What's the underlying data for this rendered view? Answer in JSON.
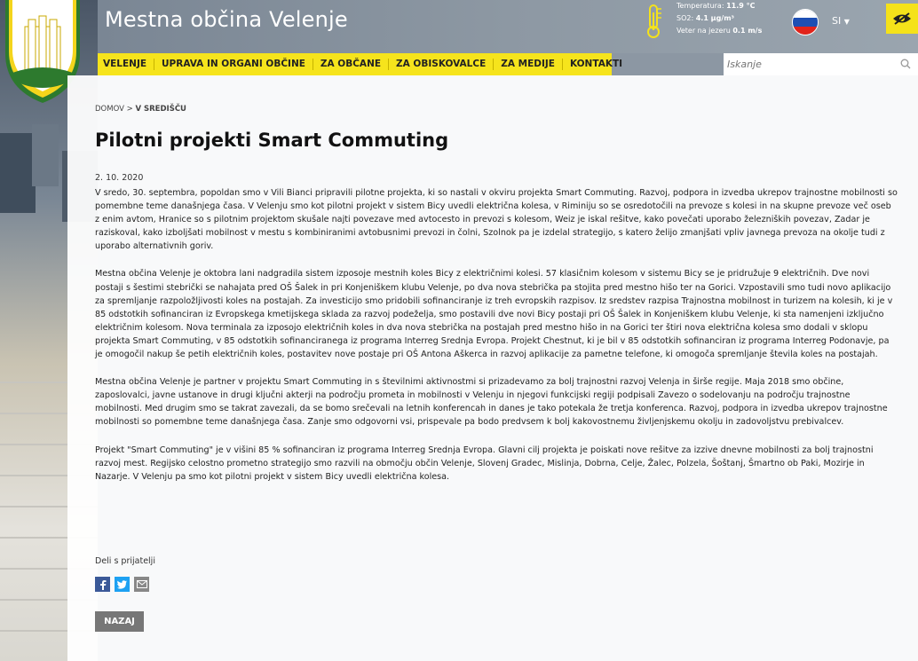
{
  "header": {
    "site_title": "Mestna občina Velenje",
    "weather": {
      "temperature_label": "Temperatura:",
      "temperature_value": "11.9 °C",
      "so2_label": "SO2:",
      "so2_value": "4.1 µg/m³",
      "wind_label": "Veter na jezeru",
      "wind_value": "0.1 m/s"
    },
    "language": "SI",
    "icons": [
      "logo-crest",
      "thermometer-icon",
      "slovenia-flag-icon",
      "chevron-down-icon",
      "eye-icon",
      "search-icon"
    ]
  },
  "nav": {
    "items": [
      "VELENJE",
      "UPRAVA IN ORGANI OBČINE",
      "ZA OBČANE",
      "ZA OBISKOVALCE",
      "ZA MEDIJE",
      "KONTAKTI"
    ]
  },
  "search": {
    "placeholder": "Iskanje"
  },
  "breadcrumb": {
    "home": "DOMOV",
    "separator": ">",
    "current": "V SREDIŠČU"
  },
  "article": {
    "title": "Pilotni projekti Smart Commuting",
    "date": "2. 10. 2020",
    "paragraphs": [
      "V sredo, 30. septembra, popoldan smo v Vili Bianci pripravili pilotne projekta, ki so nastali v okviru projekta Smart Commuting. Razvoj, podpora in izvedba ukrepov trajnostne mobilnosti so pomembne teme današnjega časa. V Velenju smo kot pilotni projekt v sistem Bicy uvedli električna kolesa, v Riminiju so se osredotočili na prevoze s kolesi in na skupne prevoze več oseb z enim avtom, Hranice so s pilotnim projektom skušale najti povezave med avtocesto in prevozi s kolesom, Weiz je iskal rešitve, kako povečati uporabo železniških povezav, Zadar je raziskoval, kako izboljšati mobilnost v mestu s kombiniranimi avtobusnimi prevozi in čolni, Szolnok pa je izdelal strategijo, s katero želijo zmanjšati vpliv javnega prevoza na okolje tudi z uporabo alternativnih goriv.",
      "Mestna občina Velenje je oktobra lani nadgradila sistem izposoje mestnih koles Bicy z električnimi kolesi. 57 klasičnim kolesom v sistemu Bicy se je pridružuje 9 električnih. Dve novi postaji s šestimi stebrički se nahajata pred OŠ Šalek in pri Konjeniškem klubu Velenje, po dva nova stebrička pa stojita pred mestno hišo ter na Gorici. Vzpostavili smo tudi novo aplikacijo za spremljanje razpoložljivosti koles na postajah. Za investicijo smo pridobili sofinanciranje iz treh evropskih razpisov. Iz sredstev razpisa Trajnostna mobilnost in turizem na kolesih, ki je v 85 odstotkih sofinanciran iz Evropskega kmetijskega sklada za razvoj podeželja, smo postavili dve novi Bicy postaji pri OŠ Šalek in Konjeniškem klubu Velenje, ki sta namenjeni izključno električnim kolesom. Nova terminala za izposojo električnih koles in dva nova stebrička na postajah pred mestno hišo in na Gorici ter štiri nova električna kolesa smo dodali v sklopu projekta Smart Commuting, v 85 odstotkih sofinanciranega iz programa Interreg Srednja Evropa. Projekt Chestnut, ki je bil v 85 odstotkih sofinanciran iz programa Interreg Podonavje, pa je omogočil nakup še petih električnih koles, postavitev nove postaje pri OŠ Antona Aškerca in razvoj aplikacije za pametne telefone, ki omogoča spremljanje števila koles na postajah.",
      "Mestna občina Velenje je partner v projektu Smart Commuting in s številnimi aktivnostmi si prizadevamo za bolj trajnostni razvoj Velenja in širše regije. Maja 2018 smo občine, zaposlovalci, javne ustanove in drugi ključni akterji na področju prometa in mobilnosti v Velenju in njegovi funkcijski regiji podpisali Zavezo o sodelovanju na področju trajnostne mobilnosti. Med drugim smo se takrat zavezali, da se bomo srečevali na letnih konferencah in danes je tako potekala že tretja konferenca. Razvoj, podpora in izvedba ukrepov trajnostne mobilnosti so pomembne teme današnjega časa. Zanje smo odgovorni vsi, prispevale pa bodo predvsem k bolj kakovostnemu življenjskemu okolju in zadovoljstvu prebivalcev.",
      "Projekt \"Smart Commuting\" je v višini 85 % sofinanciran iz programa Interreg Srednja Evropa. Glavni cilj projekta je poiskati nove rešitve za izzive dnevne mobilnosti za bolj trajnostni razvoj mest. Regijsko celostno prometno strategijo smo razvili na območju občin Velenje, Slovenj Gradec, Mislinja, Dobrna, Celje, Žalec, Polzela, Šoštanj, Šmartno ob Paki, Mozirje in Nazarje. V Velenju pa smo kot pilotni projekt v sistem Bicy uvedli električna kolesa."
    ]
  },
  "share": {
    "label": "Deli s prijatelji",
    "icons": [
      "facebook-icon",
      "twitter-icon",
      "email-icon"
    ]
  },
  "back_button": "NAZAJ",
  "colors": {
    "accent_yellow": "#f6e41c",
    "button_grey": "#777777",
    "facebook": "#3b5998",
    "twitter": "#1da1f2",
    "email": "#888888"
  }
}
